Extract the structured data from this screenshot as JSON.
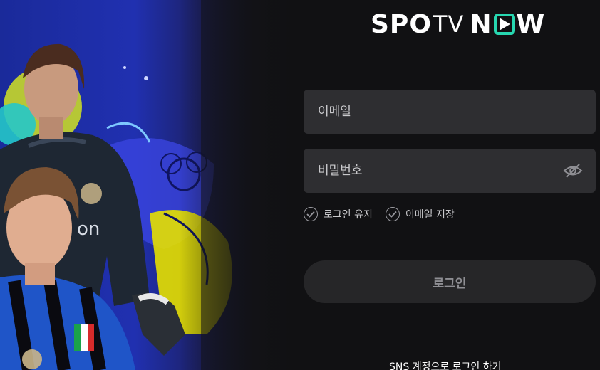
{
  "brand": {
    "logo_part1": "SPO",
    "logo_part2": "TV",
    "logo_part3a": "N",
    "logo_part3b": "W",
    "accent_color": "#27d7b0"
  },
  "hero": {
    "image_icon": "football-players-image",
    "description_icon": "promo-artwork"
  },
  "form": {
    "email_placeholder": "이메일",
    "password_placeholder": "비밀번호",
    "password_toggle_icon": "eye-hidden-icon",
    "keep_login_label": "로그인 유지",
    "save_email_label": "이메일 저장",
    "check_icon": "check-circle-icon",
    "login_button": "로그인"
  },
  "sns_login_text": "SNS 계정으로 로그인 하기"
}
